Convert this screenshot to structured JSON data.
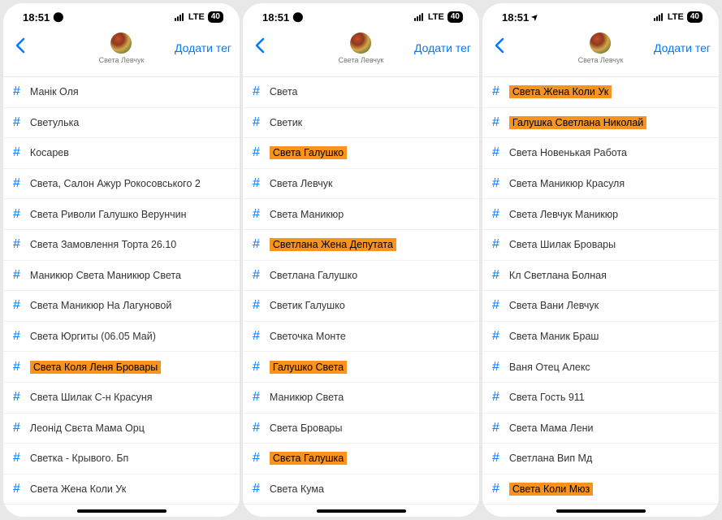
{
  "screens": [
    {
      "status": {
        "time": "18:51",
        "icon": "bell",
        "network": "LTE",
        "battery": "40"
      },
      "nav": {
        "add_tag": "Додати тег",
        "profile_name": "Света Левчук"
      },
      "items": [
        {
          "label": "Манік Оля",
          "hl": false
        },
        {
          "label": "Светулька",
          "hl": false
        },
        {
          "label": "Косарев",
          "hl": false
        },
        {
          "label": "Света, Салон Ажур Рокосовського 2",
          "hl": false
        },
        {
          "label": "Света Риволи Галушко Верунчин",
          "hl": false
        },
        {
          "label": "Света Замовлення Торта 26.10",
          "hl": false
        },
        {
          "label": "Маникюр Света Маникюр Света",
          "hl": false
        },
        {
          "label": "Света Маникюр На Лагуновой",
          "hl": false
        },
        {
          "label": "Света Юргиты (06.05 Май)",
          "hl": false
        },
        {
          "label": "Света Коля Леня Бровары",
          "hl": true
        },
        {
          "label": "Света Шилак С-н Красуня",
          "hl": false
        },
        {
          "label": "Леонід Свєта Мама Орц",
          "hl": false
        },
        {
          "label": "Светка - Крывого. Бп",
          "hl": false
        },
        {
          "label": "Света Жена Коли Ук",
          "hl": false
        }
      ]
    },
    {
      "status": {
        "time": "18:51",
        "icon": "bell",
        "network": "LTE",
        "battery": "40"
      },
      "nav": {
        "add_tag": "Додати тег",
        "profile_name": "Света Левчук"
      },
      "items": [
        {
          "label": "Света",
          "hl": false
        },
        {
          "label": "Светик",
          "hl": false
        },
        {
          "label": "Света Галушко",
          "hl": true
        },
        {
          "label": "Света Левчук",
          "hl": false
        },
        {
          "label": "Света Маникюр",
          "hl": false
        },
        {
          "label": "Светлана Жена Депутата",
          "hl": true
        },
        {
          "label": "Светлана Галушко",
          "hl": false
        },
        {
          "label": "Светик Галушко",
          "hl": false
        },
        {
          "label": "Светочка Монте",
          "hl": false
        },
        {
          "label": "Галушко Света",
          "hl": true
        },
        {
          "label": "Маникюр Света",
          "hl": false
        },
        {
          "label": "Света Бровары",
          "hl": false
        },
        {
          "label": "Свєта Галушка",
          "hl": true
        },
        {
          "label": "Света Кума",
          "hl": false
        }
      ]
    },
    {
      "status": {
        "time": "18:51",
        "icon": "arrow",
        "network": "LTE",
        "battery": "40"
      },
      "nav": {
        "add_tag": "Додати тег",
        "profile_name": "Света Левчук"
      },
      "items": [
        {
          "label": "Света Жена Коли Ук",
          "hl": true
        },
        {
          "label": "Галушка Светлана Николай",
          "hl": true
        },
        {
          "label": "Света Новенькая Работа",
          "hl": false
        },
        {
          "label": "Света Маникюр Красуля",
          "hl": false
        },
        {
          "label": "Света Левчук Маникюр",
          "hl": false
        },
        {
          "label": "Света Шилак Бровары",
          "hl": false
        },
        {
          "label": "Кл Светлана Болная",
          "hl": false
        },
        {
          "label": "Света Вани Левчук",
          "hl": false
        },
        {
          "label": "Света Маник Браш",
          "hl": false
        },
        {
          "label": "Ваня Отец Алекс",
          "hl": false
        },
        {
          "label": "Света Гость 911",
          "hl": false
        },
        {
          "label": "Света Мама Лени",
          "hl": false
        },
        {
          "label": "Светлана Вип Мд",
          "hl": false
        },
        {
          "label": "Света Коли Мюз",
          "hl": true
        }
      ]
    }
  ]
}
